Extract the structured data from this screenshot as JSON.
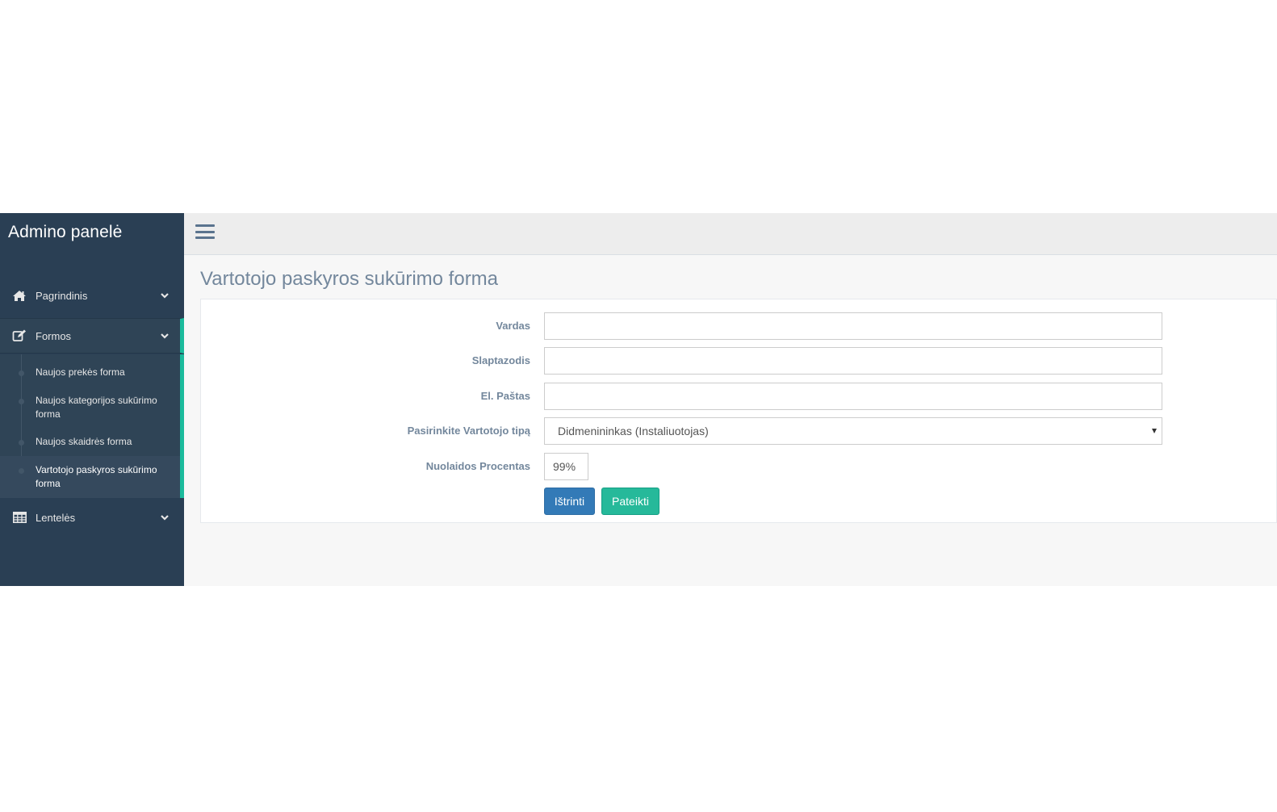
{
  "sidebar": {
    "brand": "Admino panelė",
    "menu": {
      "home": {
        "label": "Pagrindinis",
        "icon": "home-icon"
      },
      "forms": {
        "label": "Formos",
        "icon": "edit-icon",
        "submenu": [
          {
            "label": "Naujos prekės forma"
          },
          {
            "label": "Naujos kategorijos sukūrimo forma"
          },
          {
            "label": "Naujos skaidrės forma"
          },
          {
            "label": "Vartotojo paskyros sukūrimo forma",
            "active": true
          }
        ]
      },
      "tables": {
        "label": "Lentelės",
        "icon": "table-icon"
      }
    }
  },
  "topnav": {
    "menu_toggle_icon": "hamburger-icon"
  },
  "main": {
    "title": "Vartotojo paskyros sukūrimo forma",
    "form": {
      "name": {
        "label": "Vardas",
        "value": ""
      },
      "password": {
        "label": "Slaptazodis",
        "value": ""
      },
      "email": {
        "label": "El. Paštas",
        "value": ""
      },
      "user_type": {
        "label": "Pasirinkite Vartotojo tipą",
        "selected": "Didmenininkas (Instaliuotojas)"
      },
      "discount": {
        "label": "Nuolaidos Procentas",
        "value": "99%"
      },
      "delete_label": "Ištrinti",
      "submit_label": "Pateikti"
    }
  },
  "colors": {
    "sidebar_bg": "#2a3f54",
    "accent": "#1abb9c",
    "primary_button": "#337ab7",
    "success_button": "#26b99a",
    "label_text": "#73879c"
  }
}
